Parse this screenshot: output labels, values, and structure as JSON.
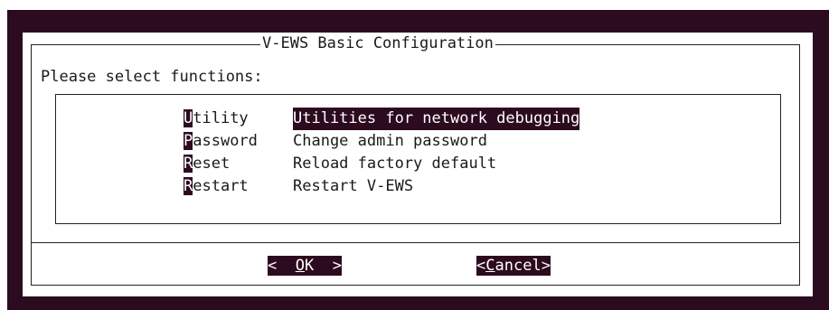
{
  "dialog": {
    "title": "V-EWS Basic Configuration",
    "prompt": "Please select functions:"
  },
  "menu": {
    "items": [
      {
        "hot": "U",
        "rest": "tility",
        "desc": "Utilities for network debugging",
        "selected": true
      },
      {
        "hot": "P",
        "rest": "assword",
        "desc": "Change admin password",
        "selected": false
      },
      {
        "hot": "R",
        "rest": "eset",
        "desc": "Reload factory default",
        "selected": false
      },
      {
        "hot": "R",
        "rest": "estart",
        "desc": "Restart V-EWS",
        "selected": false
      }
    ]
  },
  "buttons": {
    "ok": {
      "left": "<  ",
      "hot": "O",
      "rest": "K",
      "right": "  >"
    },
    "cancel": {
      "left": "<",
      "hot": "C",
      "rest": "ancel",
      "right": ">"
    }
  },
  "colors": {
    "terminal_background": "#2c0a1f",
    "dialog_background": "#ffffff",
    "highlight": "#2c0a1f"
  }
}
